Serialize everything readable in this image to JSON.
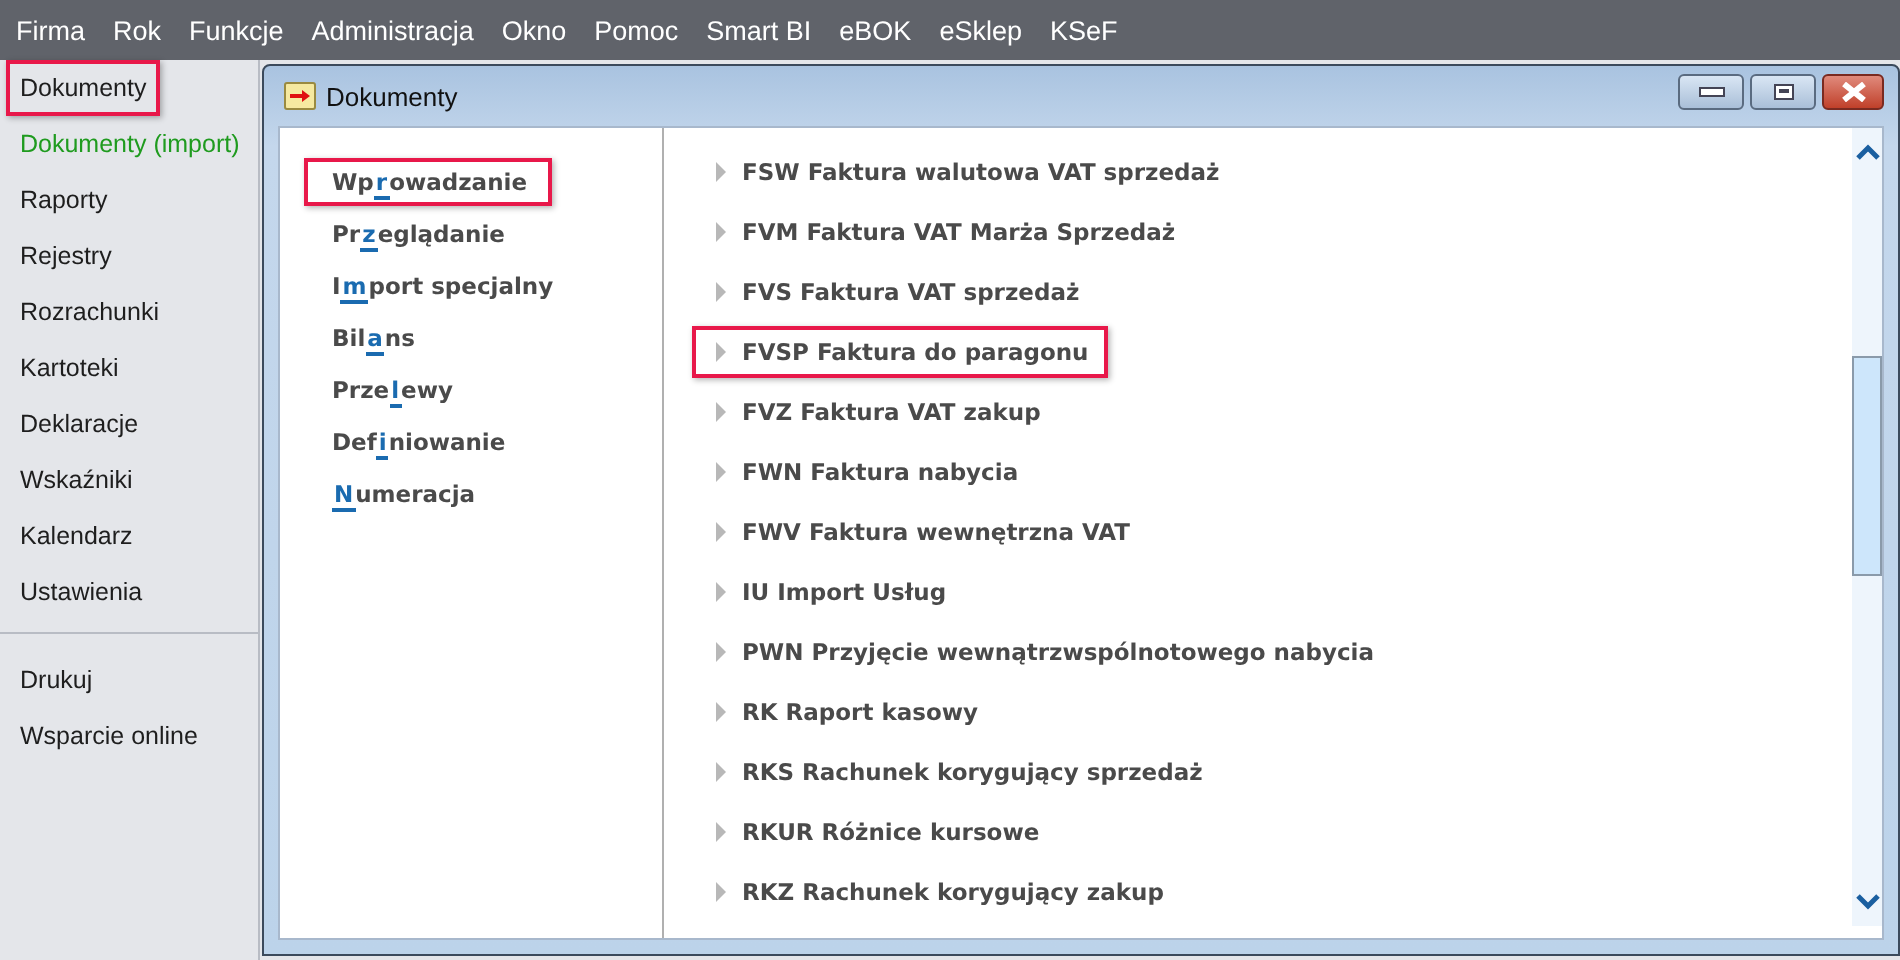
{
  "menu_bar": [
    "Firma",
    "Rok",
    "Funkcje",
    "Administracja",
    "Okno",
    "Pomoc",
    "Smart BI",
    "eBOK",
    "eSklep",
    "KSeF"
  ],
  "sidebar": {
    "groups": [
      [
        {
          "label": "Dokumenty",
          "color": "#1e1e1e",
          "highlighted": true
        },
        {
          "label": "Dokumenty (import)",
          "color": "#1f9b1f",
          "highlighted": false
        },
        {
          "label": "Raporty",
          "color": "#1e1e1e",
          "highlighted": false
        },
        {
          "label": "Rejestry",
          "color": "#1e1e1e",
          "highlighted": false
        },
        {
          "label": "Rozrachunki",
          "color": "#1e1e1e",
          "highlighted": false
        },
        {
          "label": "Kartoteki",
          "color": "#1e1e1e",
          "highlighted": false
        },
        {
          "label": "Deklaracje",
          "color": "#1e1e1e",
          "highlighted": false
        },
        {
          "label": "Wskaźniki",
          "color": "#1e1e1e",
          "highlighted": false
        },
        {
          "label": "Kalendarz",
          "color": "#1e1e1e",
          "highlighted": false
        },
        {
          "label": "Ustawienia",
          "color": "#1e1e1e",
          "highlighted": false
        }
      ],
      [
        {
          "label": "Drukuj",
          "color": "#1e1e1e",
          "highlighted": false
        },
        {
          "label": "Wsparcie online",
          "color": "#1e1e1e",
          "highlighted": false
        }
      ]
    ]
  },
  "window": {
    "title": "Dokumenty",
    "sections": [
      {
        "before": "Wp",
        "key": "r",
        "after": "owadzanie",
        "highlighted": true
      },
      {
        "before": "Pr",
        "key": "z",
        "after": "eglądanie",
        "highlighted": false
      },
      {
        "before": "I",
        "key": "m",
        "after": "port specjalny",
        "highlighted": false
      },
      {
        "before": "Bil",
        "key": "a",
        "after": "ns",
        "highlighted": false
      },
      {
        "before": "Prze",
        "key": "l",
        "after": "ewy",
        "highlighted": false
      },
      {
        "before": "Def",
        "key": "i",
        "after": "niowanie",
        "highlighted": false
      },
      {
        "key": "N",
        "after": "umeracja",
        "highlighted": false
      }
    ],
    "documents": [
      {
        "label": "FSW Faktura walutowa VAT sprzedaż",
        "highlighted": false
      },
      {
        "label": "FVM Faktura VAT Marża Sprzedaż",
        "highlighted": false
      },
      {
        "label": "FVS Faktura VAT sprzedaż",
        "highlighted": false
      },
      {
        "label": "FVSP Faktura do paragonu",
        "highlighted": true
      },
      {
        "label": "FVZ Faktura VAT zakup",
        "highlighted": false
      },
      {
        "label": "FWN Faktura nabycia",
        "highlighted": false
      },
      {
        "label": "FWV Faktura wewnętrzna VAT",
        "highlighted": false
      },
      {
        "label": "IU Import Usług",
        "highlighted": false
      },
      {
        "label": "PWN Przyjęcie wewnątrzwspólnotowego nabycia",
        "highlighted": false
      },
      {
        "label": "RK Raport kasowy",
        "highlighted": false
      },
      {
        "label": "RKS Rachunek korygujący sprzedaż",
        "highlighted": false
      },
      {
        "label": "RKUR Różnice kursowe",
        "highlighted": false
      },
      {
        "label": "RKZ Rachunek korygujący zakup",
        "highlighted": false
      }
    ]
  }
}
